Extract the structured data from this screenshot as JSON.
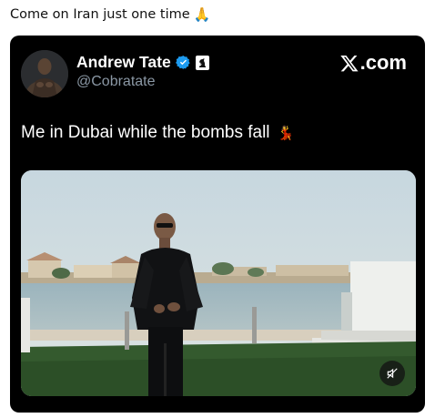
{
  "post": {
    "caption": "Come on Iran just one time",
    "caption_emoji": "🙏"
  },
  "embed": {
    "author_name": "Andrew Tate",
    "author_handle": "@Cobratate",
    "brand": ".com",
    "tweet_text": "Me in Dubai while the bombs fall",
    "tweet_emoji": "💃",
    "icons": {
      "verified": "verified-badge-icon",
      "affiliate": "chess-knight-icon",
      "brand_logo": "x-logo-icon",
      "mute": "muted-speaker-icon"
    },
    "colors": {
      "card_bg": "#000000",
      "verified_blue": "#1d9bf0",
      "handle_gray": "#8b98a5"
    }
  }
}
